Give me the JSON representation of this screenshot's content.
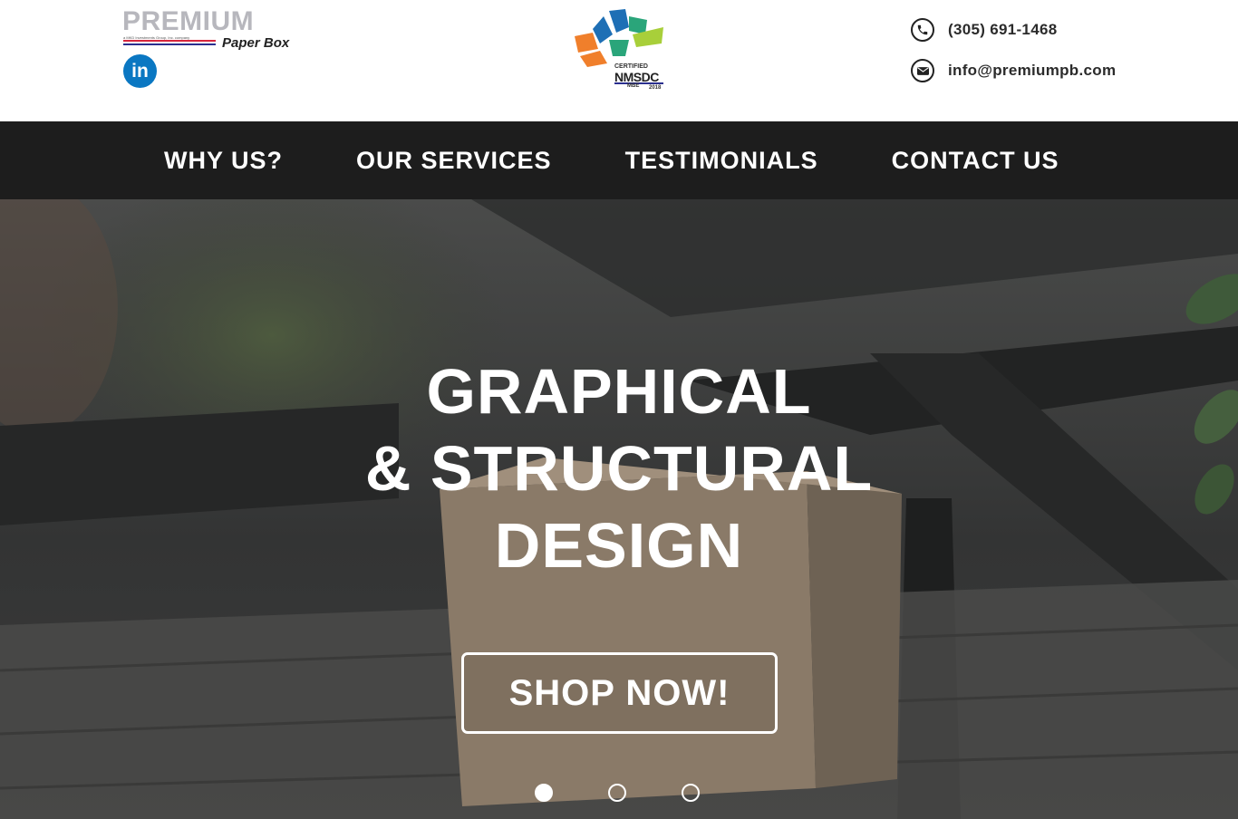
{
  "brand": {
    "name": "PREMIUM",
    "tagline_small": "a MKD Investments Group, Inc. company",
    "sub": "Paper Box",
    "linkedin": "in"
  },
  "badge": {
    "line1": "CERTIFIED",
    "line2": "NMSDC",
    "line3": "MBE",
    "year": "2018"
  },
  "contact": {
    "phone": "(305) 691-1468",
    "email": "info@premiumpb.com",
    "phone_icon": "phone-icon",
    "email_icon": "envelope-icon"
  },
  "nav": {
    "items": [
      {
        "label": "WHY US?"
      },
      {
        "label": "OUR SERVICES"
      },
      {
        "label": "TESTIMONIALS"
      },
      {
        "label": "CONTACT US"
      }
    ]
  },
  "hero": {
    "title_lines": [
      "GRAPHICAL",
      "& STRUCTURAL",
      "DESIGN"
    ],
    "cta": "SHOP NOW!",
    "slides": {
      "count": 3,
      "active": 1
    }
  },
  "colors": {
    "nav_bg": "#1d1d1d",
    "linkedin": "#0a77c2",
    "text_dark": "#2b2b2b"
  }
}
